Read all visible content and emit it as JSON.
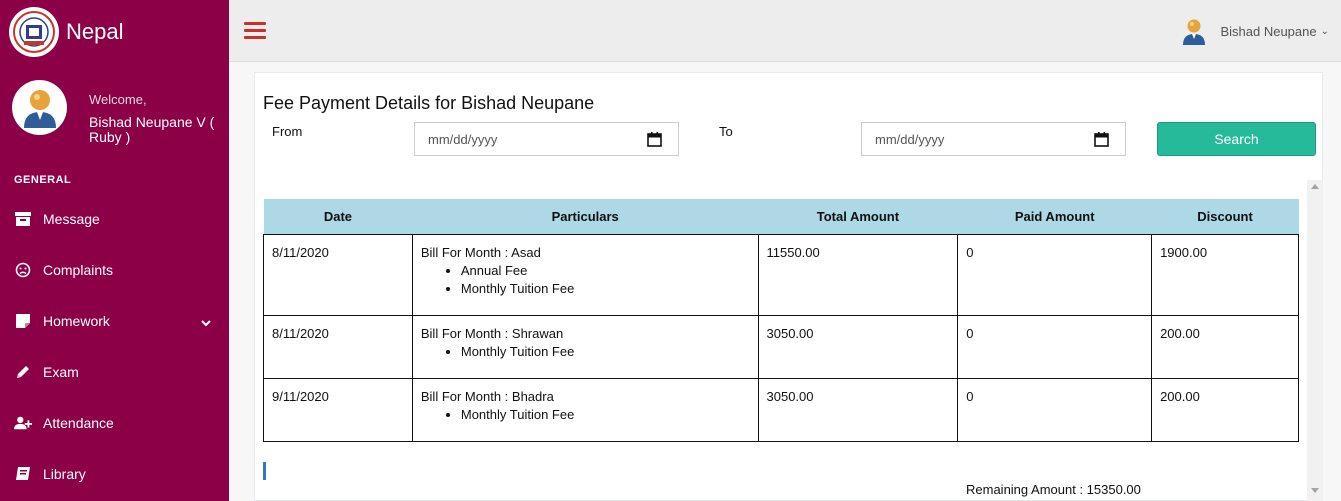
{
  "brand": {
    "name": "Nepal",
    "logo_icon": "school-logo-icon"
  },
  "sidebar": {
    "welcome": "Welcome,",
    "user_name": "Bishad Neupane V ( Ruby )",
    "section_title": "GENERAL",
    "items": [
      {
        "label": "Message",
        "icon": "archive-icon"
      },
      {
        "label": "Complaints",
        "icon": "frown-icon"
      },
      {
        "label": "Homework",
        "icon": "note-icon"
      },
      {
        "label": "Exam",
        "icon": "pencil-icon"
      },
      {
        "label": "Attendance",
        "icon": "user-plus-icon"
      },
      {
        "label": "Library",
        "icon": "book-icon"
      }
    ],
    "color": "#8c0047"
  },
  "topbar": {
    "user_name": "Bishad Neupane",
    "caret": "⌄"
  },
  "main": {
    "title": "Fee Payment Details for Bishad Neupane",
    "from_label": "From",
    "to_label": "To",
    "from_placeholder": "mm/dd/yyyy",
    "to_placeholder": "mm/dd/yyyy",
    "search_label": "Search",
    "accent": "#26b99a",
    "table": {
      "headers": [
        "Date",
        "Particulars",
        "Total Amount",
        "Paid Amount",
        "Discount"
      ],
      "rows": [
        {
          "date": "8/11/2020",
          "bill": "Bill For Month : Asad",
          "items": [
            "Annual Fee",
            "Monthly Tuition Fee"
          ],
          "total": "11550.00",
          "paid": "0",
          "discount": "1900.00"
        },
        {
          "date": "8/11/2020",
          "bill": "Bill For Month : Shrawan",
          "items": [
            "Monthly Tuition Fee"
          ],
          "total": "3050.00",
          "paid": "0",
          "discount": "200.00"
        },
        {
          "date": "9/11/2020",
          "bill": "Bill For Month : Bhadra",
          "items": [
            "Monthly Tuition Fee"
          ],
          "total": "3050.00",
          "paid": "0",
          "discount": "200.00"
        }
      ]
    },
    "remaining": "Remaining Amount : 15350.00"
  }
}
